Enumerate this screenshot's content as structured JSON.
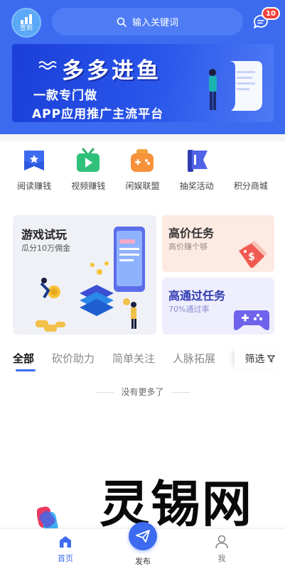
{
  "header": {
    "checkin_label": "签到",
    "search_placeholder": "输入关键词",
    "message_badge": "10"
  },
  "banner": {
    "title": "多多进鱼",
    "line1": "一款专门做",
    "line2": "APP应用推广主流平台"
  },
  "categories": [
    {
      "label": "阅读赚钱",
      "icon": "book-star-icon"
    },
    {
      "label": "视频赚钱",
      "icon": "tv-play-icon"
    },
    {
      "label": "闲娱联盟",
      "icon": "gamepad-bag-icon"
    },
    {
      "label": "抽奖活动",
      "icon": "flag-icon"
    },
    {
      "label": "积分商城",
      "icon": "points-mall-icon"
    }
  ],
  "promo": {
    "game": {
      "title": "游戏试玩",
      "subtitle": "瓜分10万佣金"
    },
    "high_price": {
      "title": "高价任务",
      "subtitle": "高价赚个够"
    },
    "high_pass": {
      "title": "高通过任务",
      "subtitle": "70%通过率"
    }
  },
  "tabs": [
    "全部",
    "砍价助力",
    "简单关注",
    "人脉拓展"
  ],
  "filter_label": "筛选",
  "empty_text": "没有更多了",
  "watermark": "灵锡网",
  "tabbar": {
    "home": "首页",
    "publish": "发布",
    "me": "我"
  },
  "colors": {
    "primary": "#3d6bf0",
    "badge": "#f2413b"
  }
}
